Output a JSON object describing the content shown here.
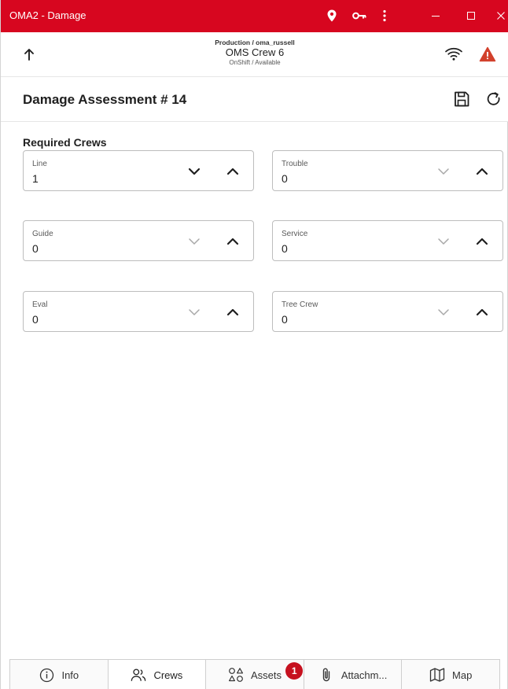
{
  "window": {
    "title": "OMA2 - Damage",
    "accent_color": "#d7061f",
    "titlebar_icons": [
      "location-pin-icon",
      "key-icon",
      "more-vertical-icon"
    ],
    "controls": [
      "minimize-icon",
      "maximize-icon",
      "close-icon"
    ]
  },
  "header": {
    "environment": "Production / oma_russell",
    "crew": "OMS Crew 6",
    "status": "OnShift / Available",
    "icons": [
      "back-arrow-icon",
      "wifi-icon",
      "warning-icon"
    ],
    "warning_color": "#d2402b"
  },
  "page": {
    "title": "Damage Assessment # 14",
    "actions": [
      "save-icon",
      "refresh-icon"
    ]
  },
  "crews": {
    "section_title": "Required Crews",
    "fields": [
      {
        "label": "Line",
        "value": "1"
      },
      {
        "label": "Trouble",
        "value": "0"
      },
      {
        "label": "Guide",
        "value": "0"
      },
      {
        "label": "Service",
        "value": "0"
      },
      {
        "label": "Eval",
        "value": "0"
      },
      {
        "label": "Tree Crew",
        "value": "0"
      }
    ]
  },
  "tabs": [
    {
      "label": "Info",
      "icon": "info-icon",
      "active": false
    },
    {
      "label": "Crews",
      "icon": "people-icon",
      "active": true
    },
    {
      "label": "Assets",
      "icon": "shapes-icon",
      "active": false,
      "badge": "1"
    },
    {
      "label": "Attachm...",
      "icon": "paperclip-icon",
      "active": false
    },
    {
      "label": "Map",
      "icon": "map-icon",
      "active": false
    }
  ],
  "badge_color": "#c6111f"
}
